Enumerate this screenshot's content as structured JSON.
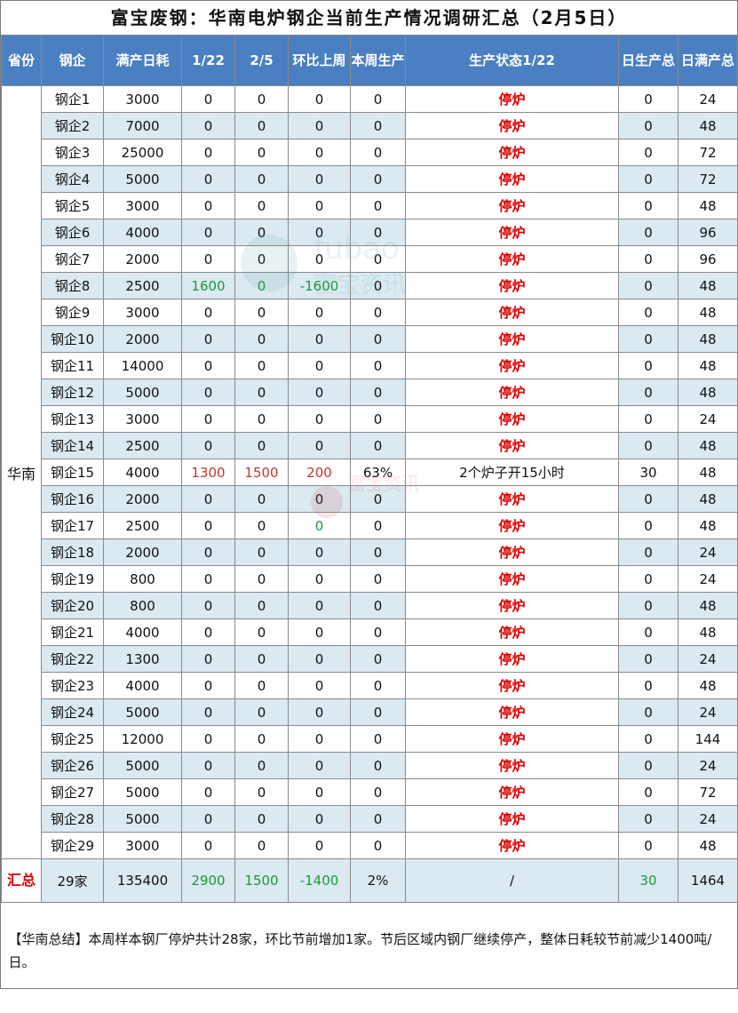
{
  "title": "富宝废钢：华南电炉钢企当前生产情况调研汇总（2月5日）",
  "headers": [
    "省份",
    "钢企",
    "满产日耗",
    "1/22",
    "2/5",
    "环比上周",
    "本周生产",
    "生产状态1/22",
    "日生产总",
    "日满产总"
  ],
  "province": "华南",
  "rows": [
    [
      "钢企1",
      "3000",
      "0",
      "0",
      "0",
      "0",
      "停炉",
      "0",
      "24"
    ],
    [
      "钢企2",
      "7000",
      "0",
      "0",
      "0",
      "0",
      "停炉",
      "0",
      "48"
    ],
    [
      "钢企3",
      "25000",
      "0",
      "0",
      "0",
      "0",
      "停炉",
      "0",
      "72"
    ],
    [
      "钢企4",
      "5000",
      "0",
      "0",
      "0",
      "0",
      "停炉",
      "0",
      "72"
    ],
    [
      "钢企5",
      "3000",
      "0",
      "0",
      "0",
      "0",
      "停炉",
      "0",
      "48"
    ],
    [
      "钢企6",
      "4000",
      "0",
      "0",
      "0",
      "0",
      "停炉",
      "0",
      "96"
    ],
    [
      "钢企7",
      "2000",
      "0",
      "0",
      "0",
      "0",
      "停炉",
      "0",
      "96"
    ],
    [
      "钢企8",
      "2500",
      "1600",
      "0",
      "-1600",
      "0",
      "停炉",
      "0",
      "48"
    ],
    [
      "钢企9",
      "3000",
      "0",
      "0",
      "0",
      "0",
      "停炉",
      "0",
      "48"
    ],
    [
      "钢企10",
      "2000",
      "0",
      "0",
      "0",
      "0",
      "停炉",
      "0",
      "48"
    ],
    [
      "钢企11",
      "14000",
      "0",
      "0",
      "0",
      "0",
      "停炉",
      "0",
      "48"
    ],
    [
      "钢企12",
      "5000",
      "0",
      "0",
      "0",
      "0",
      "停炉",
      "0",
      "48"
    ],
    [
      "钢企13",
      "3000",
      "0",
      "0",
      "0",
      "0",
      "停炉",
      "0",
      "24"
    ],
    [
      "钢企14",
      "2500",
      "0",
      "0",
      "0",
      "0",
      "停炉",
      "0",
      "48"
    ],
    [
      "钢企15",
      "4000",
      "1300",
      "1500",
      "200",
      "63%",
      "2个炉子开15小时",
      "30",
      "48"
    ],
    [
      "钢企16",
      "2000",
      "0",
      "0",
      "0",
      "0",
      "停炉",
      "0",
      "48"
    ],
    [
      "钢企17",
      "2500",
      "0",
      "0",
      "0",
      "0",
      "停炉",
      "0",
      "48"
    ],
    [
      "钢企18",
      "2000",
      "0",
      "0",
      "0",
      "0",
      "停炉",
      "0",
      "24"
    ],
    [
      "钢企19",
      "800",
      "0",
      "0",
      "0",
      "0",
      "停炉",
      "0",
      "24"
    ],
    [
      "钢企20",
      "800",
      "0",
      "0",
      "0",
      "0",
      "停炉",
      "0",
      "48"
    ],
    [
      "钢企21",
      "4000",
      "0",
      "0",
      "0",
      "0",
      "停炉",
      "0",
      "48"
    ],
    [
      "钢企22",
      "1300",
      "0",
      "0",
      "0",
      "0",
      "停炉",
      "0",
      "24"
    ],
    [
      "钢企23",
      "4000",
      "0",
      "0",
      "0",
      "0",
      "停炉",
      "0",
      "48"
    ],
    [
      "钢企24",
      "5000",
      "0",
      "0",
      "0",
      "0",
      "停炉",
      "0",
      "24"
    ],
    [
      "钢企25",
      "12000",
      "0",
      "0",
      "0",
      "0",
      "停炉",
      "0",
      "144"
    ],
    [
      "钢企26",
      "5000",
      "0",
      "0",
      "0",
      "0",
      "停炉",
      "0",
      "24"
    ],
    [
      "钢企27",
      "5000",
      "0",
      "0",
      "0",
      "0",
      "停炉",
      "0",
      "72"
    ],
    [
      "钢企28",
      "5000",
      "0",
      "0",
      "0",
      "0",
      "停炉",
      "0",
      "24"
    ],
    [
      "钢企29",
      "3000",
      "0",
      "0",
      "0",
      "0",
      "停炉",
      "0",
      "48"
    ]
  ],
  "total": {
    "label": "汇总",
    "count": "29家",
    "capacity": "135400",
    "d122": "2900",
    "d25": "1500",
    "change": "-1400",
    "week": "2%",
    "status": "/",
    "daily": "30",
    "full": "1464"
  },
  "summary": "【华南总结】本周样本钢厂停炉共计28家，环比节前增加1家。节后区域内钢厂继续停产，整体日耗较节前减少1400吨/日。",
  "watermark": {
    "latin": "fubao",
    "cn": "富宝资讯"
  },
  "colors": {
    "header_bg": "#4a7fc1",
    "stripe": "#dbe9f1",
    "stop_red": "#e00000",
    "green": "#1a9a3a",
    "red": "#c0392b"
  }
}
